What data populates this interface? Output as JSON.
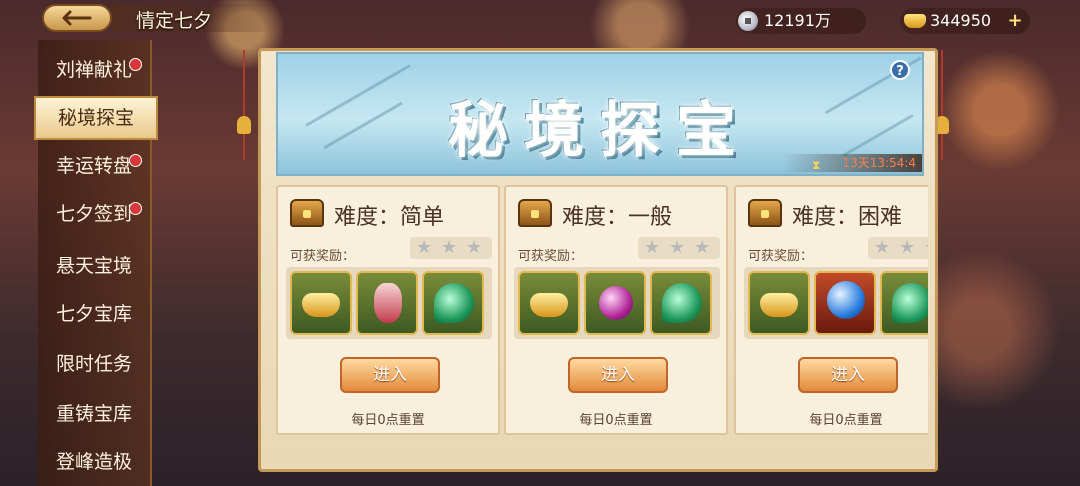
{
  "header": {
    "title": "情定七夕",
    "silver_amount": "12191万",
    "gold_amount": "344950",
    "back_icon": "back-arrow-icon",
    "plus_icon": "plus-icon"
  },
  "sidebar": {
    "items": [
      {
        "label": "刘禅献礼",
        "dot": true
      },
      {
        "label": "秘境探宝",
        "dot": false,
        "active": true
      },
      {
        "label": "幸运转盘",
        "dot": true
      },
      {
        "label": "七夕签到",
        "dot": true
      },
      {
        "label": "悬天宝境",
        "dot": false
      },
      {
        "label": "七夕宝库",
        "dot": false
      },
      {
        "label": "限时任务",
        "dot": false
      },
      {
        "label": "重铸宝库",
        "dot": false
      },
      {
        "label": "登峰造极",
        "dot": false
      }
    ]
  },
  "banner": {
    "title": "秘境探宝",
    "timer": "13天13:54:4",
    "help": "?"
  },
  "cards": [
    {
      "title": "难度：简单",
      "reward_label": "可获奖励：",
      "stars": 3,
      "rewards": [
        "gold-ingot",
        "red-potion",
        "jade-pendant"
      ],
      "button": "进入",
      "reset": "每日0点重置"
    },
    {
      "title": "难度：一般",
      "reward_label": "可获奖励：",
      "stars": 3,
      "rewards": [
        "gold-ingot",
        "purple-orb",
        "jade-pendant"
      ],
      "button": "进入",
      "reset": "每日0点重置"
    },
    {
      "title": "难度：困难",
      "reward_label": "可获奖励：",
      "stars": 3,
      "rewards": [
        "gold-ingot",
        "crystal-ball",
        "jade-pendant"
      ],
      "button": "进入",
      "reset": "每日0点重置"
    }
  ],
  "colors": {
    "accent": "#e28a3a",
    "panel": "#f3e6cd",
    "banner": "#9fd1e6",
    "notify_dot": "#d8383a"
  }
}
